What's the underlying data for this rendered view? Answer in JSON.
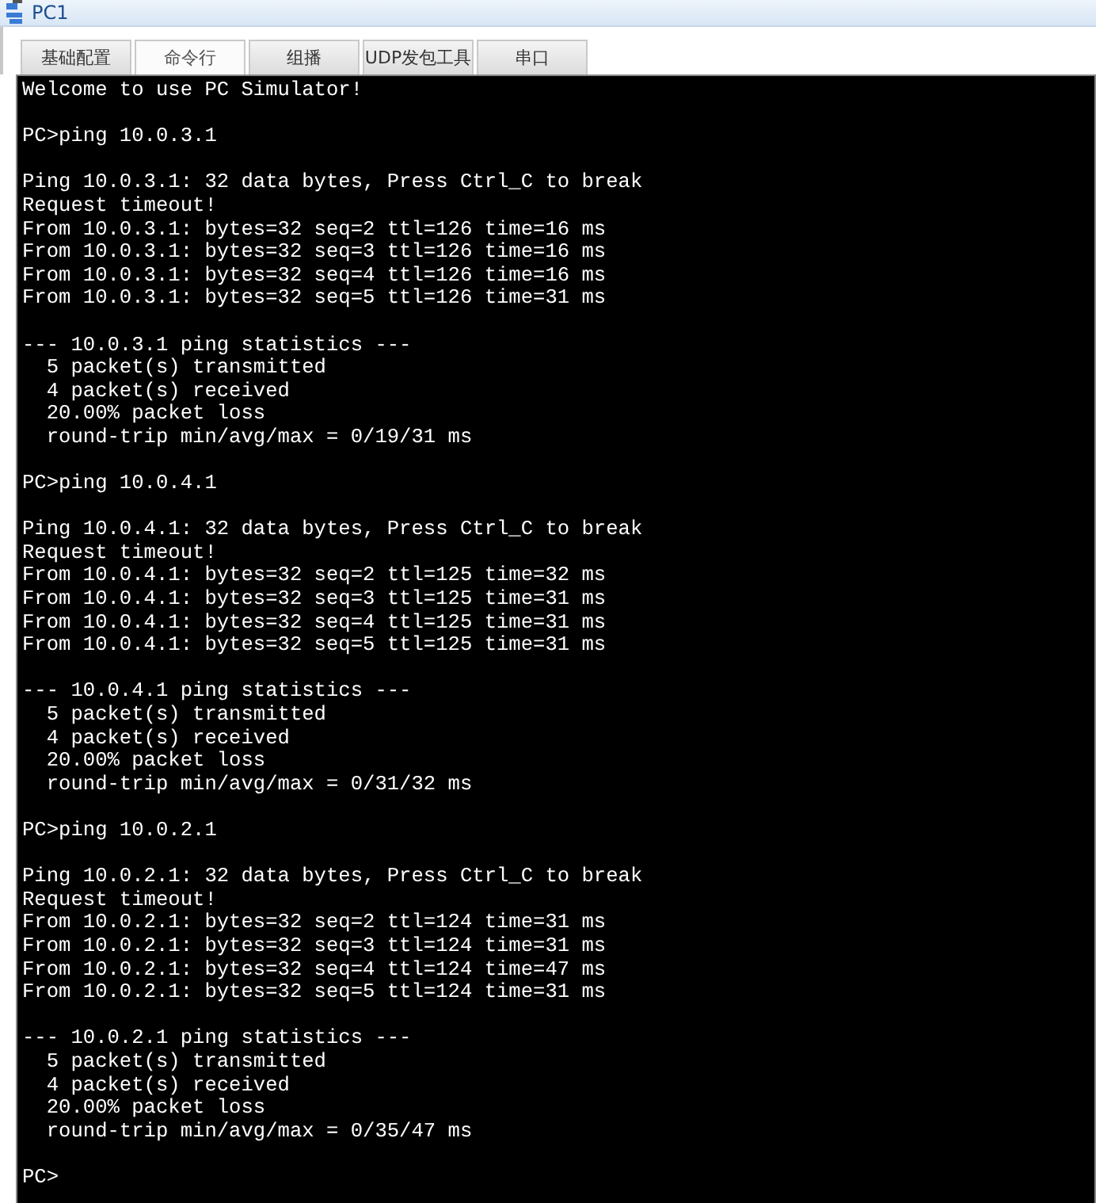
{
  "window": {
    "title": "PC1"
  },
  "tabs": [
    {
      "label": "基础配置",
      "selected": false
    },
    {
      "label": "命令行",
      "selected": true
    },
    {
      "label": "组播",
      "selected": false
    },
    {
      "label": "UDP发包工具",
      "selected": false
    },
    {
      "label": "串口",
      "selected": false
    }
  ],
  "terminal": {
    "blocks": [
      [
        "Welcome to use PC Simulator!"
      ],
      [
        "PC>ping 10.0.3.1"
      ],
      [
        "Ping 10.0.3.1: 32 data bytes, Press Ctrl_C to break",
        "Request timeout!",
        "From 10.0.3.1: bytes=32 seq=2 ttl=126 time=16 ms",
        "From 10.0.3.1: bytes=32 seq=3 ttl=126 time=16 ms",
        "From 10.0.3.1: bytes=32 seq=4 ttl=126 time=16 ms",
        "From 10.0.3.1: bytes=32 seq=5 ttl=126 time=31 ms"
      ],
      [
        "--- 10.0.3.1 ping statistics ---",
        "  5 packet(s) transmitted",
        "  4 packet(s) received",
        "  20.00% packet loss",
        "  round-trip min/avg/max = 0/19/31 ms"
      ],
      [
        "PC>ping 10.0.4.1"
      ],
      [
        "Ping 10.0.4.1: 32 data bytes, Press Ctrl_C to break",
        "Request timeout!",
        "From 10.0.4.1: bytes=32 seq=2 ttl=125 time=32 ms",
        "From 10.0.4.1: bytes=32 seq=3 ttl=125 time=31 ms",
        "From 10.0.4.1: bytes=32 seq=4 ttl=125 time=31 ms",
        "From 10.0.4.1: bytes=32 seq=5 ttl=125 time=31 ms"
      ],
      [
        "--- 10.0.4.1 ping statistics ---",
        "  5 packet(s) transmitted",
        "  4 packet(s) received",
        "  20.00% packet loss",
        "  round-trip min/avg/max = 0/31/32 ms"
      ],
      [
        "PC>ping 10.0.2.1"
      ],
      [
        "Ping 10.0.2.1: 32 data bytes, Press Ctrl_C to break",
        "Request timeout!",
        "From 10.0.2.1: bytes=32 seq=2 ttl=124 time=31 ms",
        "From 10.0.2.1: bytes=32 seq=3 ttl=124 time=31 ms",
        "From 10.0.2.1: bytes=32 seq=4 ttl=124 time=47 ms",
        "From 10.0.2.1: bytes=32 seq=5 ttl=124 time=31 ms"
      ],
      [
        "--- 10.0.2.1 ping statistics ---",
        "  5 packet(s) transmitted",
        "  4 packet(s) received",
        "  20.00% packet loss",
        "  round-trip min/avg/max = 0/35/47 ms"
      ],
      [
        "PC>"
      ]
    ]
  }
}
